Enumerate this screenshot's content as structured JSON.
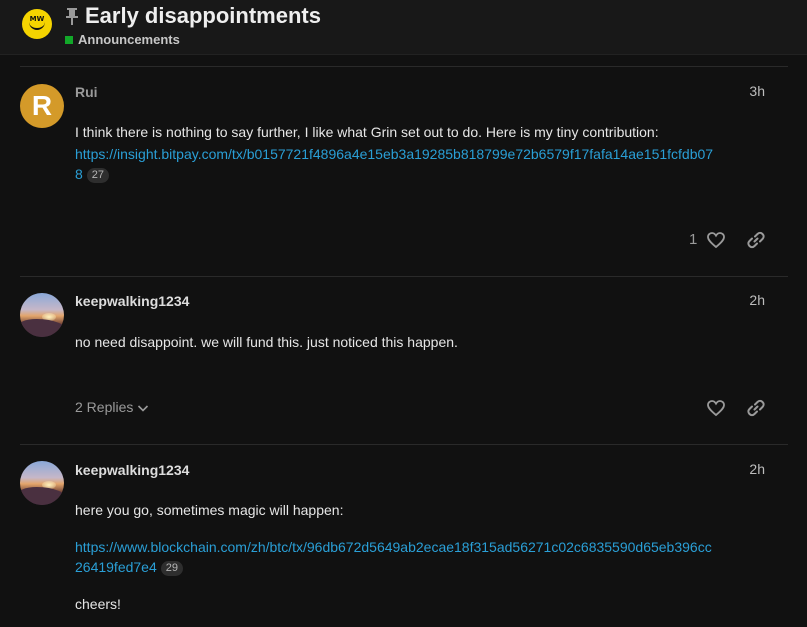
{
  "header": {
    "logo_text": "MW",
    "title": "Early disappointments",
    "category": "Announcements",
    "category_color": "#12a829",
    "icons": [
      "grin-logo",
      "pin-icon"
    ]
  },
  "colors": {
    "link": "#2a9fd6",
    "avatar_letter_bg": "#d49a29"
  },
  "posts": [
    {
      "avatar_letter": "R",
      "username": "Rui",
      "time": "3h",
      "text": "I think there is nothing to say further, I like what Grin set out to do. Here is my tiny contribution:",
      "link_line1": "https://insight.bitpay.com/tx/b0157721f4896a4e15eb3a19285b818799e72b6579f17fafa14ae151fcfdb07",
      "link_line2": "8",
      "link_clicks": "27",
      "likes": "1"
    },
    {
      "username": "keepwalking1234",
      "time": "2h",
      "text": "no need disappoint. we will fund this. just noticed this happen.",
      "replies": "2 Replies"
    },
    {
      "username": "keepwalking1234",
      "time": "2h",
      "text": "here you go, sometimes magic will happen:",
      "link_line1": "https://www.blockchain.com/zh/btc/tx/96db672d5649ab2ecae18f315ad56271c02c6835590d65eb396cc",
      "link_line2": "26419fed7e4",
      "link_clicks": "29",
      "closing": "cheers!"
    }
  ]
}
